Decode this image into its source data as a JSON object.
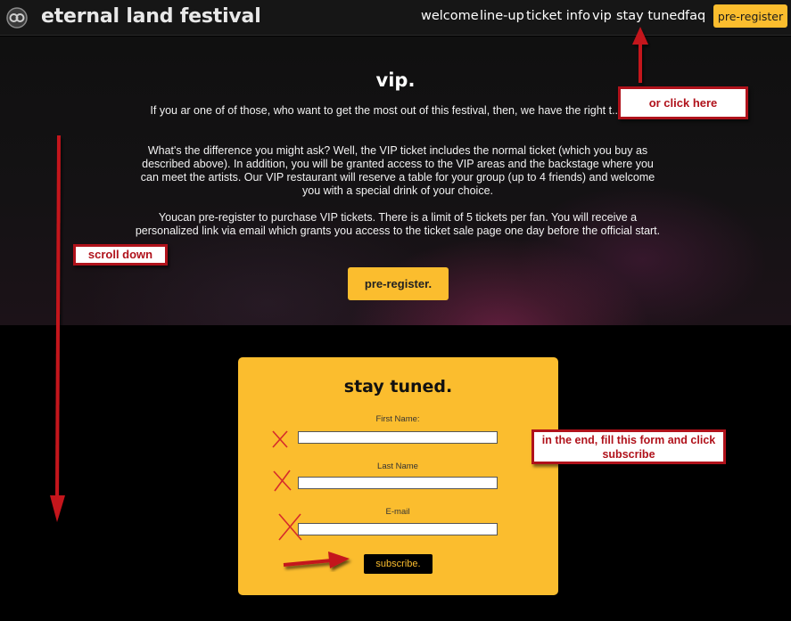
{
  "header": {
    "brand": "eternal land festival",
    "nav": [
      {
        "id": "welcome",
        "label": "welcome"
      },
      {
        "id": "line-up",
        "label": "line-up"
      },
      {
        "id": "ticket-info",
        "label": "ticket info"
      },
      {
        "id": "vip",
        "label": "vip"
      },
      {
        "id": "stay-tuned",
        "label": "stay tuned"
      },
      {
        "id": "faq",
        "label": "faq"
      }
    ],
    "cta_label": "pre-register"
  },
  "hero": {
    "title": "vip.",
    "paragraphs": [
      "If you ar one of of those, who want to get the most out of this festival, then, we have the right t... you.",
      "What's the difference you might ask? Well, the VIP ticket includes the normal ticket (which you buy as described above). In addition, you will be granted access to the VIP areas and the backstage where you can meet the artists. Our VIP restaurant will reserve a table for your group (up to 4 friends) and welcome you with a special drink of your choice.",
      "Youcan pre-register to purchase VIP tickets. There is a limit of 5 tickets per fan. You will receive a personalized link via email which grants you access to the ticket sale page one day before the official start."
    ],
    "cta_label": "pre-register."
  },
  "form": {
    "title": "stay tuned.",
    "fields": [
      {
        "label": "First Name:",
        "value": ""
      },
      {
        "label": "Last Name",
        "value": ""
      },
      {
        "label": "E-mail",
        "value": ""
      }
    ],
    "submit_label": "subscribe."
  },
  "annotations": {
    "click_here": "or click here",
    "scroll_down": "scroll down",
    "fill_form": "in the end, fill this form and click subscribe"
  },
  "colors": {
    "accent": "#fbbd2e",
    "annotation_red": "#b0121b",
    "background": "#000000"
  }
}
